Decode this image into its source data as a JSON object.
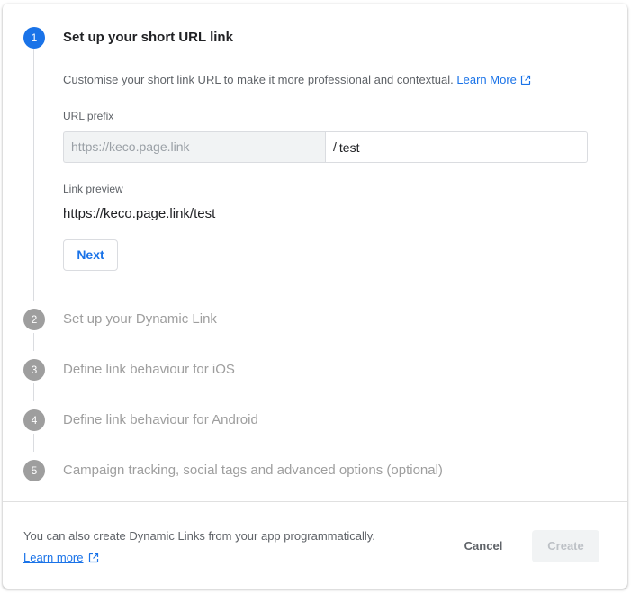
{
  "steps": [
    {
      "number": "1",
      "title": "Set up your short URL link",
      "active": true
    },
    {
      "number": "2",
      "title": "Set up your Dynamic Link",
      "active": false
    },
    {
      "number": "3",
      "title": "Define link behaviour for iOS",
      "active": false
    },
    {
      "number": "4",
      "title": "Define link behaviour for Android",
      "active": false
    },
    {
      "number": "5",
      "title": "Campaign tracking, social tags and advanced options (optional)",
      "active": false
    }
  ],
  "step1": {
    "description": "Customise your short link URL to make it more professional and contextual.",
    "learn_more": "Learn More",
    "url_prefix_label": "URL prefix",
    "prefix_value": "https://keco.page.link",
    "separator": "/",
    "suffix_value": "test",
    "preview_label": "Link preview",
    "preview_value": "https://keco.page.link/test",
    "next_label": "Next"
  },
  "footer": {
    "text": "You can also create Dynamic Links from your app programmatically.",
    "learn_more": "Learn more",
    "cancel_label": "Cancel",
    "create_label": "Create"
  },
  "colors": {
    "accent": "#1a73e8",
    "inactive_step": "#9e9e9e"
  }
}
